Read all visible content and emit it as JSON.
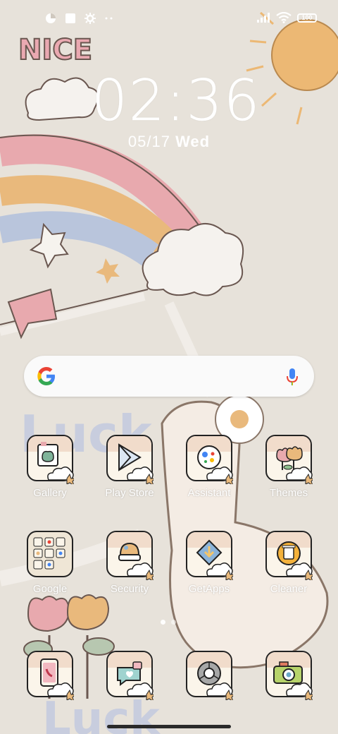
{
  "status_bar": {
    "icons_left": [
      "data-saver-icon",
      "square-notification-icon",
      "settings-gear-icon",
      "more-dots-icon"
    ],
    "icons_right": [
      "signal-icon",
      "wifi-icon",
      "battery-icon"
    ],
    "battery_level": "100"
  },
  "lockscreen": {
    "clock": "02:36",
    "date": "05/17",
    "weekday": "Wed"
  },
  "wallpaper": {
    "text_top": "NICE",
    "text_bottom": "Luck"
  },
  "search": {
    "logo": "G",
    "mic_icon": "mic-icon"
  },
  "apps": [
    {
      "label": "Gallery",
      "icon": "gallery-icon"
    },
    {
      "label": "Play Store",
      "icon": "play-store-icon"
    },
    {
      "label": "Assistant",
      "icon": "assistant-icon"
    },
    {
      "label": "Themes",
      "icon": "themes-icon"
    },
    {
      "label": "Google",
      "icon": "google-folder-icon"
    },
    {
      "label": "Security",
      "icon": "security-icon"
    },
    {
      "label": "GetApps",
      "icon": "getapps-icon"
    },
    {
      "label": "Cleaner",
      "icon": "cleaner-icon"
    }
  ],
  "dock": [
    {
      "label": "",
      "icon": "phone-icon"
    },
    {
      "label": "",
      "icon": "messages-icon"
    },
    {
      "label": "",
      "icon": "chrome-icon"
    },
    {
      "label": "",
      "icon": "camera-icon"
    }
  ],
  "page_indicator": {
    "current": 1,
    "total": 2
  },
  "colors": {
    "background": "#e7e2da",
    "rainbow_pink": "#e8a9ae",
    "rainbow_orange": "#e9b97c",
    "rainbow_blue": "#b9c5dc",
    "sun": "#ecb874"
  }
}
